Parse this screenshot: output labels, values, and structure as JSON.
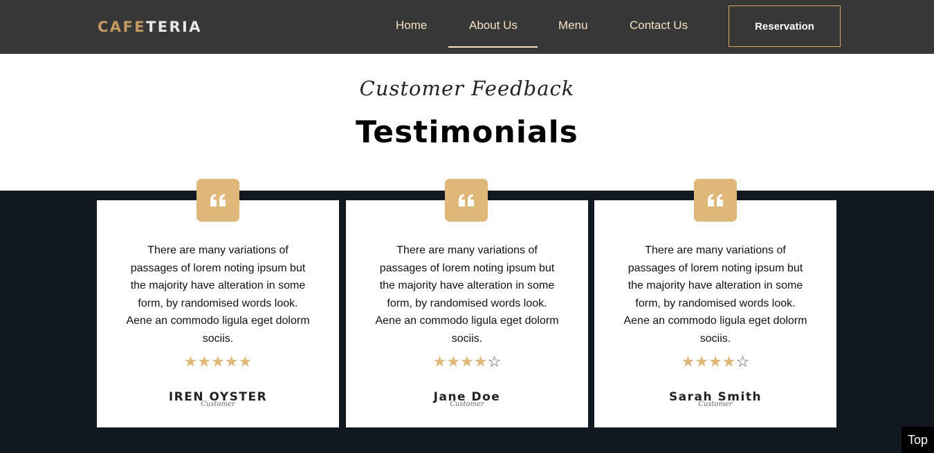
{
  "brand": {
    "logo_part1": "CAFE",
    "logo_part2": "TERIA"
  },
  "nav": {
    "items": [
      {
        "label": "Home"
      },
      {
        "label": "About Us",
        "active": true
      },
      {
        "label": "Menu"
      },
      {
        "label": "Contact Us"
      }
    ],
    "reservation_label": "Reservation"
  },
  "section": {
    "subtitle": "Customer Feedback",
    "title": "Testimonials"
  },
  "testimonials": [
    {
      "text": "There are many variations of passages of lorem noting ipsum but the majority have alteration in some form, by randomised words look. Aene an commodo ligula eget dolorm sociis.",
      "rating": 5,
      "max_rating": 5,
      "name": "IREN OYSTER",
      "role": "Customer"
    },
    {
      "text": "There are many variations of passages of lorem noting ipsum but the majority have alteration in some form, by randomised words look. Aene an commodo ligula eget dolorm sociis.",
      "rating": 4,
      "max_rating": 5,
      "name": "Jane Doe",
      "role": "Customer"
    },
    {
      "text": "There are many variations of passages of lorem noting ipsum but the majority have alteration in some form, by randomised words look. Aene an commodo ligula eget dolorm sociis.",
      "rating": 4,
      "max_rating": 5,
      "name": "Sarah Smith",
      "role": "Customer"
    }
  ],
  "back_to_top_label": "Top",
  "colors": {
    "navbar_bg": "#373737",
    "accent_gold": "#dfb779",
    "nav_text": "#f6e2c5",
    "dark_section_bg": "#11181f"
  },
  "icons": {
    "quote": "quote-icon",
    "star": "star-icon"
  }
}
